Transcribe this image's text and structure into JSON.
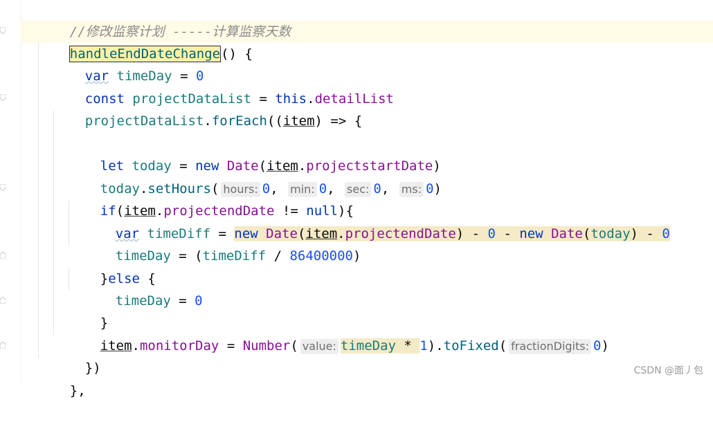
{
  "editor": {
    "comment": "//修改监察计划 -----计算监察天数",
    "fn_name": "handleEndDateChange",
    "fn_open": "() {",
    "l3": {
      "kw": "var",
      "name": "timeDay",
      "op": " = ",
      "num": "0"
    },
    "l4": {
      "kw": "const",
      "name": "projectDataList",
      "op": " = ",
      "this": "this",
      "dot": ".",
      "prop": "detailList"
    },
    "l5": {
      "obj": "projectDataList",
      "dot": ".",
      "method": "forEach",
      "p1": "((",
      "param": "item",
      "p2": ") => {"
    },
    "l7": {
      "kw": "let",
      "name": "today",
      "op": " = ",
      "new": "new",
      "cls": "Date",
      "p1": "(",
      "obj": "item",
      "dot": ".",
      "prop": "projectstartDate",
      "p2": ")"
    },
    "l8": {
      "obj": "today",
      "dot": ".",
      "method": "setHours",
      "p1": "(",
      "h_hours": "hours:",
      "v_hours": "0",
      "c1": ",",
      "h_min": "min:",
      "v_min": "0",
      "c2": ",",
      "h_sec": "sec:",
      "v_sec": "0",
      "c3": ",",
      "h_ms": "ms:",
      "v_ms": "0",
      "p2": ")"
    },
    "l9": {
      "kw": "if",
      "p1": "(",
      "obj": "item",
      "dot": ".",
      "prop": "projectendDate",
      "op": " != ",
      "null": "null",
      "p2": "){"
    },
    "l10": {
      "kw": "var",
      "name": "timeDiff",
      "op": " = ",
      "new1": "new",
      "cls1": "Date",
      "p1": "(",
      "obj": "item",
      "dot": ".",
      "prop": "projectendDate",
      "p2": ")",
      "minus1": " - ",
      "zero1": "0",
      "minus2": " - ",
      "new2": "new",
      "cls2": "Date",
      "p3": "(",
      "today": "today",
      "p4": ")",
      "minus3": " - ",
      "zero2": "0"
    },
    "l11": {
      "name": "timeDay",
      "op": " = (",
      "var": "timeDiff",
      "div": " / ",
      "num": "86400000",
      "p": ")"
    },
    "l12": {
      "brace": "}",
      "kw": "else",
      "rest": " {"
    },
    "l13": {
      "name": "timeDay",
      "op": " = ",
      "num": "0"
    },
    "l14": {
      "brace": "}"
    },
    "l15": {
      "obj": "item",
      "dot": ".",
      "prop": "monitorDay",
      "op": " = ",
      "cls": "Number",
      "p1": "(",
      "h_value": "value:",
      "var": "timeDay",
      "mul": " * ",
      "one": "1",
      "p2": ").",
      "method": "toFixed",
      "p3": "(",
      "h_fd": "fractionDigits:",
      "zero": "0",
      "p4": ")"
    },
    "l16": {
      "text": "})"
    },
    "l17": {
      "text": "},"
    }
  },
  "watermark": "CSDN @面丿包"
}
